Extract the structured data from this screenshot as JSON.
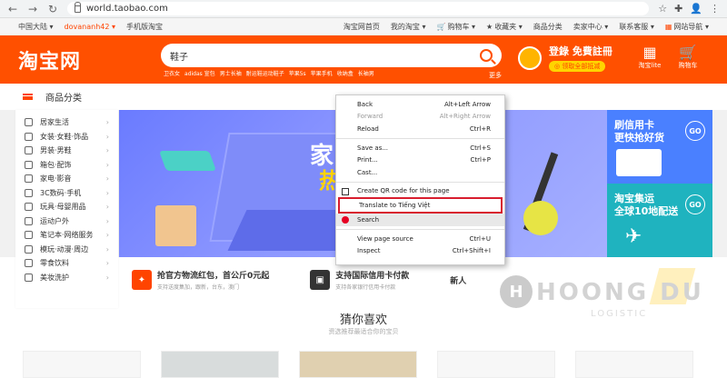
{
  "browser": {
    "url": "world.taobao.com",
    "back": "←",
    "forward": "→",
    "reload": "↻",
    "right_icons": [
      "☆",
      "✚",
      "👤",
      "⋮"
    ]
  },
  "topbar": {
    "left": [
      "中国大陆 ▾",
      "dovananh42 ▾",
      "手机版淘宝"
    ],
    "right": [
      "淘宝网首页",
      "我的淘宝 ▾",
      "购物车 ▾",
      "收藏夹 ▾",
      "商品分类",
      "卖家中心 ▾",
      "联系客服 ▾",
      "网站导航 ▾"
    ]
  },
  "header": {
    "logo": "淘宝网",
    "search_value": "鞋子",
    "hotwords": [
      "卫衣女",
      "adidas 宣包",
      "男士长袖",
      "耐运鞋运动鞋子",
      "苹果5s",
      "苹果手机",
      "收纳盒",
      "长袖男"
    ],
    "more": "更多",
    "login": "登錄",
    "register": "免費註冊",
    "coupon_btn": "◎ 领取全部抵减",
    "taobao_lite": "淘宝lite",
    "cart": "购物车"
  },
  "category_bar": {
    "label": "商品分类"
  },
  "sidebar": {
    "items": [
      "居家生活",
      "女装·女鞋·饰品",
      "男装·男鞋",
      "箱包·配饰",
      "家电·影音",
      "3C数码·手机",
      "玩具·母婴用品",
      "运动户外",
      "笔记本·网络服务",
      "模玩·动漫·周边",
      "零食饮料",
      "美妆洗护"
    ]
  },
  "banner": {
    "title": "家",
    "title2": "热"
  },
  "promos": [
    {
      "line1": "刷信用卡",
      "line2": "更快抢好货",
      "go": "GO"
    },
    {
      "line1": "淘宝集运",
      "line2": "全球10地配送",
      "go": "GO"
    }
  ],
  "info": [
    {
      "title": "抢官方物流红包，首公斤0元起",
      "sub": "支持送度集加，跟新，台东，澳门"
    },
    {
      "title": "支持国际信用卡付款",
      "sub": "支持各家银行信用卡付款"
    },
    {
      "title": "新人",
      "sub": ""
    }
  ],
  "section": {
    "title": "猜你喜欢",
    "subtitle": "资选推荐最适合你的宝贝"
  },
  "watermark": {
    "text": "HOONG DU",
    "sub": "LOGISTIC"
  },
  "context_menu": {
    "group1": [
      {
        "label": "Back",
        "shortcut": "Alt+Left Arrow"
      },
      {
        "label": "Forward",
        "shortcut": "Alt+Right Arrow"
      },
      {
        "label": "Reload",
        "shortcut": "Ctrl+R"
      }
    ],
    "group2": [
      {
        "label": "Save as...",
        "shortcut": "Ctrl+S"
      },
      {
        "label": "Print...",
        "shortcut": "Ctrl+P"
      },
      {
        "label": "Cast...",
        "shortcut": ""
      }
    ],
    "group3": [
      {
        "label": "Create QR code for this page",
        "shortcut": ""
      },
      {
        "label": "Translate to Tiếng Việt",
        "shortcut": ""
      },
      {
        "label": "Search",
        "shortcut": ""
      }
    ],
    "group4": [
      {
        "label": "View page source",
        "shortcut": "Ctrl+U"
      },
      {
        "label": "Inspect",
        "shortcut": "Ctrl+Shift+I"
      }
    ]
  }
}
